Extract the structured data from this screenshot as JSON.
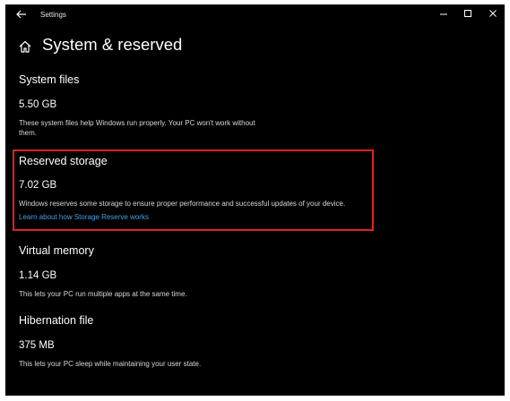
{
  "window": {
    "app_title": "Settings",
    "controls": {
      "back_icon": "back-arrow-icon",
      "minimize_icon": "minimize-icon",
      "maximize_icon": "maximize-icon",
      "close_icon": "close-icon"
    }
  },
  "page": {
    "home_icon": "home-icon",
    "title": "System & reserved"
  },
  "sections": {
    "system_files": {
      "heading": "System files",
      "size": "5.50 GB",
      "description": "These system files help Windows run properly. Your PC won't work without them."
    },
    "reserved_storage": {
      "heading": "Reserved storage",
      "size": "7.02 GB",
      "description": "Windows reserves some storage to ensure proper performance and successful updates of your device.",
      "link": "Learn about how Storage Reserve works",
      "highlight_color": "#e0241b"
    },
    "virtual_memory": {
      "heading": "Virtual memory",
      "size": "1.14 GB",
      "description": "This lets your PC run multiple apps at the same time."
    },
    "hibernation_file": {
      "heading": "Hibernation file",
      "size": "375 MB",
      "description": "This lets your PC sleep while maintaining your user state."
    }
  },
  "colors": {
    "background": "#000000",
    "text": "#ffffff",
    "link": "#4a9fe0"
  }
}
